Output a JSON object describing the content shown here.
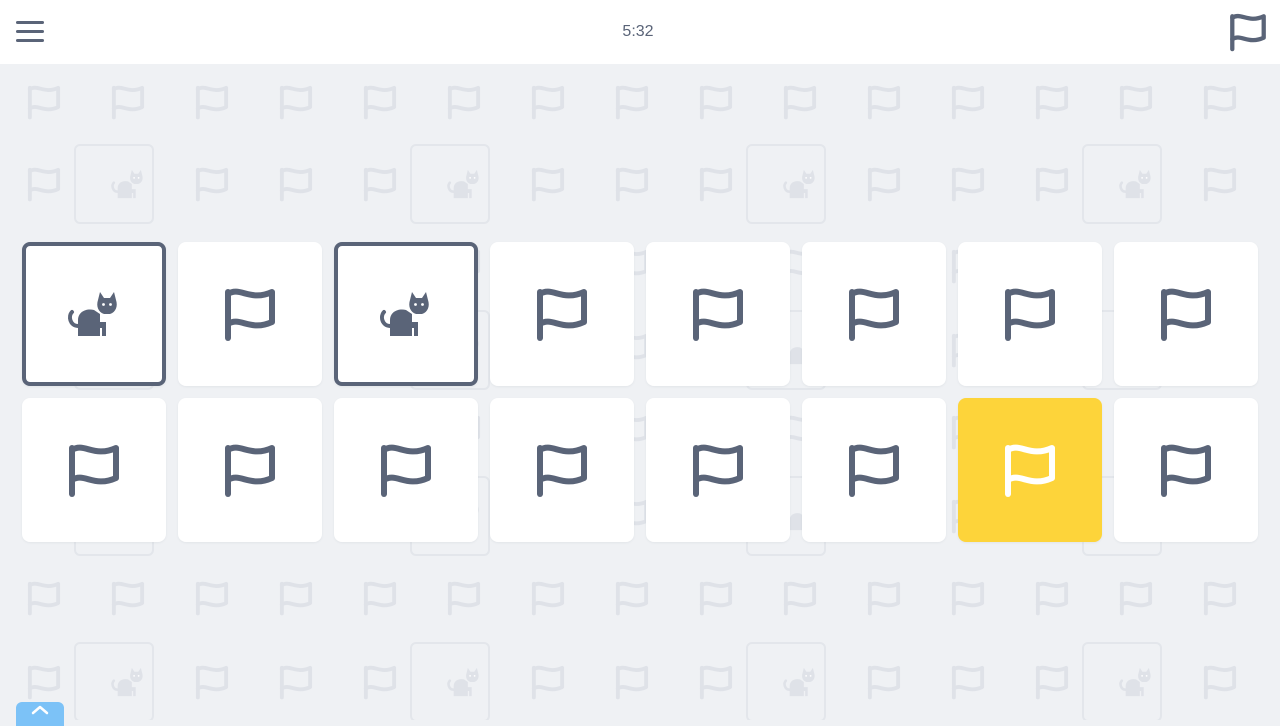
{
  "header": {
    "timer": "5:32",
    "menu_icon": "hamburger-menu-icon",
    "flag_icon": "flag-icon"
  },
  "colors": {
    "tile_background": "#ffffff",
    "tile_border": "#5a6478",
    "icon": "#5a6478",
    "highlight": "#fdd43a",
    "page_background": "#eff1f4",
    "scroll_button": "#7cc2f7"
  },
  "board": {
    "rows": 2,
    "columns": 8,
    "tiles": [
      {
        "icon": "cat-icon",
        "state": "revealed"
      },
      {
        "icon": "flag-icon",
        "state": "hidden"
      },
      {
        "icon": "cat-icon",
        "state": "revealed"
      },
      {
        "icon": "flag-icon",
        "state": "hidden"
      },
      {
        "icon": "flag-icon",
        "state": "hidden"
      },
      {
        "icon": "flag-icon",
        "state": "hidden"
      },
      {
        "icon": "flag-icon",
        "state": "hidden"
      },
      {
        "icon": "flag-icon",
        "state": "hidden"
      },
      {
        "icon": "flag-icon",
        "state": "hidden"
      },
      {
        "icon": "flag-icon",
        "state": "hidden"
      },
      {
        "icon": "flag-icon",
        "state": "hidden"
      },
      {
        "icon": "flag-icon",
        "state": "hidden"
      },
      {
        "icon": "flag-icon",
        "state": "hidden"
      },
      {
        "icon": "flag-icon",
        "state": "hidden"
      },
      {
        "icon": "flag-icon",
        "state": "selected"
      },
      {
        "icon": "flag-icon",
        "state": "hidden"
      }
    ]
  },
  "scroll_button_icon": "chevron-up-icon"
}
